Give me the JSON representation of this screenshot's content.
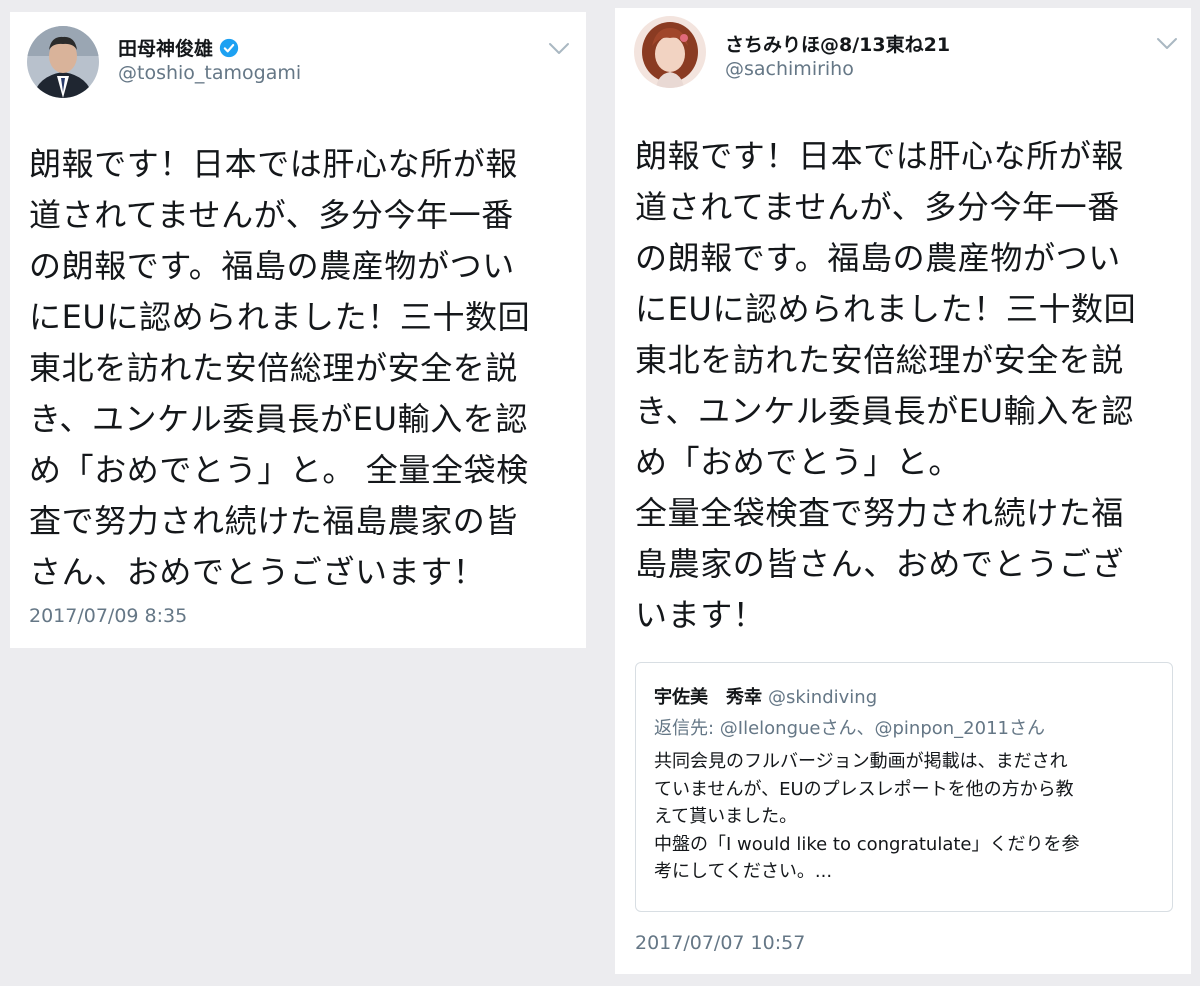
{
  "left_tweet": {
    "display_name": "田母神俊雄",
    "verified_icon": "verified-badge-icon",
    "handle": "@toshio_tamogami",
    "body_lines": [
      "朗報です！日本では肝心な所が報",
      "道されてませんが、多分今年一番",
      "の朗報です。福島の農産物がつい",
      "にEUに認められました！三十数回",
      "東北を訪れた安倍総理が安全を説",
      "き、ユンケル委員長がEU輸入を認",
      "め「おめでとう」と。 全量全袋検",
      "査で努力され続けた福島農家の皆",
      "さん、おめでとうございます！"
    ],
    "timestamp": "2017/07/09 8:35"
  },
  "right_tweet": {
    "display_name": "さちみりほ@8/13東ね21",
    "handle": "@sachimiriho",
    "body_lines": [
      "朗報です！日本では肝心な所が報",
      "道されてませんが、多分今年一番",
      "の朗報です。福島の農産物がつい",
      "にEUに認められました！三十数回",
      "東北を訪れた安倍総理が安全を説",
      "き、ユンケル委員長がEU輸入を認",
      "め「おめでとう」と。",
      "全量全袋検査で努力され続けた福",
      "島農家の皆さん、おめでとうござ",
      "います！"
    ],
    "quoted": {
      "display_name": "宇佐美　秀幸",
      "handle": "@skindiving",
      "reply_to": "返信先: @Ilelongueさん、@pinpon_2011さん",
      "body_lines": [
        "共同会見のフルバージョン動画が掲載は、まだされ",
        "ていませんが、EUのプレスレポートを他の方から教",
        "えて貰いました。",
        "中盤の「I would like to congratulate」くだりを参",
        "考にしてください。..."
      ]
    },
    "timestamp": "2017/07/07 10:57"
  },
  "icons": {
    "menu": "chevron-down-icon",
    "verified": "verified-badge-icon"
  },
  "colors": {
    "page_bg": "#ececef",
    "card_bg": "#ffffff",
    "text": "#14171a",
    "secondary_text": "#657786",
    "verified": "#1da1f2"
  }
}
